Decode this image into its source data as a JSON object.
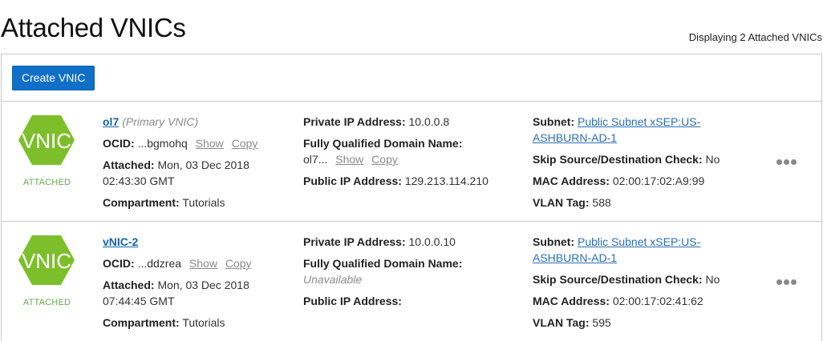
{
  "header": {
    "title": "Attached VNICs",
    "count_text": "Displaying 2 Attached VNICs"
  },
  "toolbar": {
    "create_label": "Create VNIC"
  },
  "colors": {
    "accent": "#1070c8",
    "badge_green": "#7cbf2b",
    "attached_green": "#6aa84f",
    "link_blue": "#1565a8"
  },
  "vnics": [
    {
      "badge_text": "VNIC",
      "state": "ATTACHED",
      "name": "ol7",
      "primary_tag": "(Primary VNIC)",
      "ocid_label": "OCID:",
      "ocid_value": "...bgmohq",
      "show_label": "Show",
      "copy_label": "Copy",
      "attached_label": "Attached:",
      "attached_value": "Mon, 03 Dec 2018 02:43:30 GMT",
      "compartment_label": "Compartment:",
      "compartment_value": "Tutorials",
      "private_ip_label": "Private IP Address:",
      "private_ip_value": "10.0.0.8",
      "fqdn_label": "Fully Qualified Domain Name:",
      "fqdn_value": "ol7...",
      "fqdn_show": "Show",
      "fqdn_copy": "Copy",
      "public_ip_label": "Public IP Address:",
      "public_ip_value": "129.213.114.210",
      "subnet_label": "Subnet:",
      "subnet_value": "Public Subnet xSEP:US-ASHBURN-AD-1",
      "skip_label": "Skip Source/Destination Check:",
      "skip_value": "No",
      "mac_label": "MAC Address:",
      "mac_value": "02:00:17:02:A9:99",
      "vlan_label": "VLAN Tag:",
      "vlan_value": "588"
    },
    {
      "badge_text": "VNIC",
      "state": "ATTACHED",
      "name": "vNIC-2",
      "ocid_label": "OCID:",
      "ocid_value": "...ddzrea",
      "show_label": "Show",
      "copy_label": "Copy",
      "attached_label": "Attached:",
      "attached_value": "Mon, 03 Dec 2018 07:44:45 GMT",
      "compartment_label": "Compartment:",
      "compartment_value": "Tutorials",
      "private_ip_label": "Private IP Address:",
      "private_ip_value": "10.0.0.10",
      "fqdn_label": "Fully Qualified Domain Name:",
      "fqdn_value": "Unavailable",
      "public_ip_label": "Public IP Address:",
      "public_ip_value": "",
      "subnet_label": "Subnet:",
      "subnet_value": "Public Subnet xSEP:US-ASHBURN-AD-1",
      "skip_label": "Skip Source/Destination Check:",
      "skip_value": "No",
      "mac_label": "MAC Address:",
      "mac_value": "02:00:17:02:41:62",
      "vlan_label": "VLAN Tag:",
      "vlan_value": "595"
    }
  ]
}
